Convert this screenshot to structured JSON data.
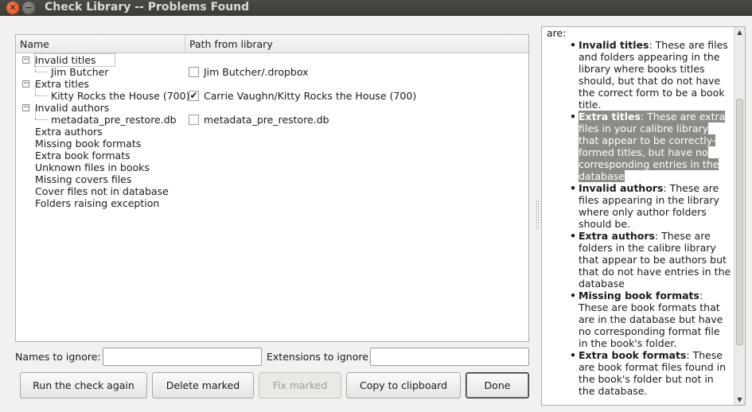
{
  "window": {
    "title": "Check Library -- Problems Found"
  },
  "tree": {
    "columns": {
      "name": "Name",
      "path": "Path from library"
    },
    "rows": [
      {
        "name": "Invalid titles",
        "path": "",
        "level": 0,
        "expander": "−",
        "checkbox": false,
        "checked": false
      },
      {
        "name": "Jim Butcher",
        "path": "Jim Butcher/.dropbox",
        "level": 1,
        "expander": "",
        "checkbox": true,
        "checked": false
      },
      {
        "name": "Extra titles",
        "path": "",
        "level": 0,
        "expander": "−",
        "checkbox": false,
        "checked": false
      },
      {
        "name": "Kitty Rocks the House (700)",
        "path": "Carrie Vaughn/Kitty Rocks the House (700)",
        "level": 1,
        "expander": "",
        "checkbox": true,
        "checked": true
      },
      {
        "name": "Invalid authors",
        "path": "",
        "level": 0,
        "expander": "−",
        "checkbox": false,
        "checked": false
      },
      {
        "name": "metadata_pre_restore.db",
        "path": "metadata_pre_restore.db",
        "level": 1,
        "expander": "",
        "checkbox": true,
        "checked": false
      },
      {
        "name": "Extra authors",
        "path": "",
        "level": 0,
        "expander": "",
        "checkbox": false,
        "checked": false
      },
      {
        "name": "Missing book formats",
        "path": "",
        "level": 0,
        "expander": "",
        "checkbox": false,
        "checked": false
      },
      {
        "name": "Extra book formats",
        "path": "",
        "level": 0,
        "expander": "",
        "checkbox": false,
        "checked": false
      },
      {
        "name": "Unknown files in books",
        "path": "",
        "level": 0,
        "expander": "",
        "checkbox": false,
        "checked": false
      },
      {
        "name": "Missing covers files",
        "path": "",
        "level": 0,
        "expander": "",
        "checkbox": false,
        "checked": false
      },
      {
        "name": "Cover files not in database",
        "path": "",
        "level": 0,
        "expander": "",
        "checkbox": false,
        "checked": false
      },
      {
        "name": "Folders raising exception",
        "path": "",
        "level": 0,
        "expander": "",
        "checkbox": false,
        "checked": false
      }
    ]
  },
  "help": {
    "intro": "are:",
    "items": [
      {
        "term": "Invalid titles",
        "desc": ": These are files and folders appearing in the library where books titles should, but that do not have the correct form to be a book title.",
        "highlighted": false
      },
      {
        "term": "Extra titles",
        "desc": ": These are extra files in your calibre library that appear to be correctly-formed titles, but have no corresponding entries in the database",
        "highlighted": true
      },
      {
        "term": "Invalid authors",
        "desc": ": These are files appearing in the library where only author folders should be.",
        "highlighted": false
      },
      {
        "term": "Extra authors",
        "desc": ": These are folders in the calibre library that appear to be authors but that do not have entries in the database",
        "highlighted": false
      },
      {
        "term": "Missing book formats",
        "desc": ": These are book formats that are in the database but have no corresponding format file in the book's folder.",
        "highlighted": false
      },
      {
        "term": "Extra book formats",
        "desc": ": These are book format files found in the book's folder but not in the database.",
        "highlighted": false
      }
    ]
  },
  "ignore": {
    "names_label": "Names to ignore:",
    "names_value": "",
    "extensions_label": "Extensions to ignore",
    "extensions_value": ""
  },
  "buttons": {
    "run_again": "Run the check again",
    "delete_marked": "Delete marked",
    "fix_marked": "Fix marked",
    "copy_clipboard": "Copy to clipboard",
    "done": "Done"
  },
  "colors": {
    "titlebar": "#3c3b37",
    "close_button": "#dd4814",
    "help_highlight": "#8c8b84"
  }
}
